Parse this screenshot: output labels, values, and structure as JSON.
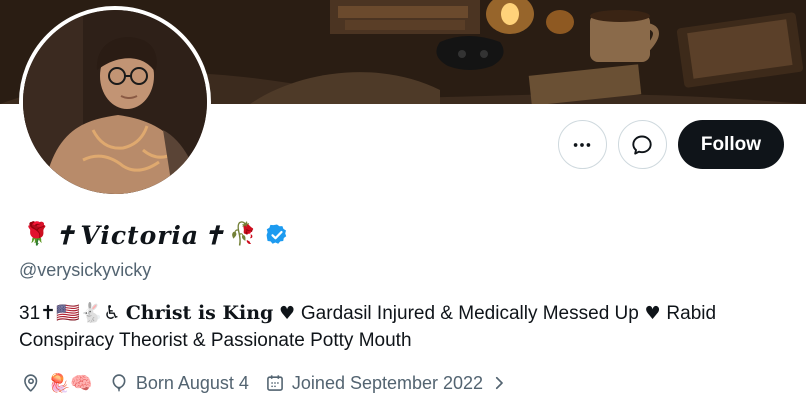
{
  "profile": {
    "name_prefix": "🌹",
    "cross_left": "✝",
    "display_name": "Victoria",
    "cross_right": "✝",
    "name_suffix": "🥀",
    "handle": "@verysickyvicky"
  },
  "actions": {
    "more_label": "•••",
    "follow_label": "Follow"
  },
  "bio": {
    "part1": "31✝🇺🇸🐇♿ ",
    "gothic": "Christ is King",
    "heart": " ♥ ",
    "part2": "Gardasil Injured & Medically Messed Up",
    "heart2": " ♥ ",
    "part3": "Rabid Conspiracy Theorist & Passionate Potty Mouth"
  },
  "meta": {
    "location_text": "🪼🧠",
    "birthday_text": "Born August 4",
    "joined_text": "Joined September 2022"
  },
  "icons": {
    "more": "more-icon",
    "message": "message-icon",
    "verified": "verified-badge-icon",
    "location": "location-icon",
    "birthday": "balloon-icon",
    "calendar": "calendar-icon",
    "chevron": "chevron-right-icon"
  },
  "colors": {
    "verified": "#1d9bf0",
    "follow_bg": "#0f1419",
    "secondary_text": "#536471"
  }
}
